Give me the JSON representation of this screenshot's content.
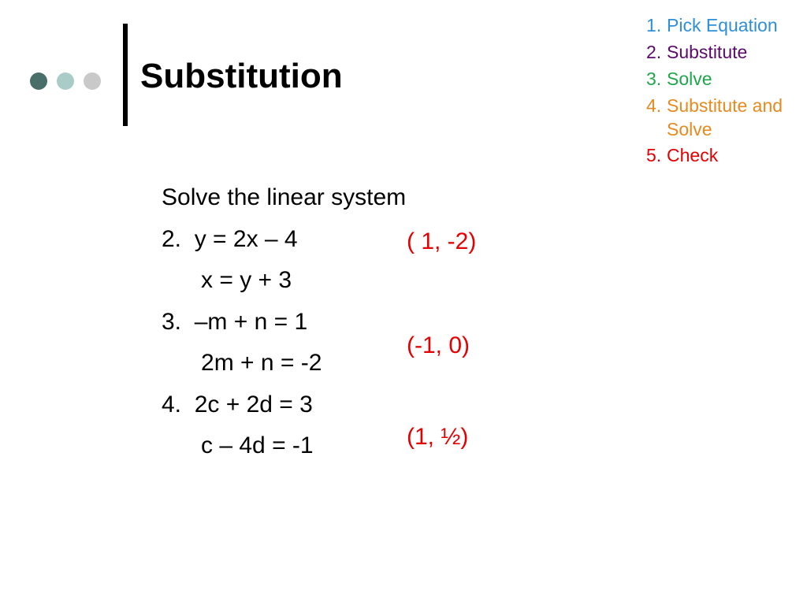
{
  "title": "Substitution",
  "prompt": "Solve the linear system",
  "problems": [
    {
      "num": "2.",
      "line1": "y = 2x – 4",
      "line2": "x = y + 3",
      "answer": "( 1, -2)"
    },
    {
      "num": "3.",
      "line1": "–m + n = 1",
      "line2": "2m + n = -2",
      "answer": "(-1, 0)"
    },
    {
      "num": "4.",
      "line1": "2c + 2d = 3",
      "line2": "c – 4d = -1",
      "answer": "(1, ½)"
    }
  ],
  "steps": [
    {
      "n": "1.",
      "text": "Pick Equation",
      "color": "#2f8fd6"
    },
    {
      "n": "2.",
      "text": "Substitute",
      "color": "#5a0a6a"
    },
    {
      "n": "3.",
      "text": "Solve",
      "color": "#1fa54a"
    },
    {
      "n": "4.",
      "text": "Substitute and Solve",
      "color": "#e58a1f"
    },
    {
      "n": "5.",
      "text": "Check",
      "color": "#e40000"
    }
  ]
}
